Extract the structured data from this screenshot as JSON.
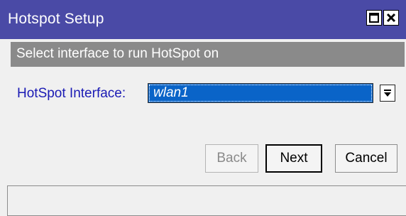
{
  "window": {
    "title": "Hotspot Setup",
    "maximize_icon": "maximize-icon",
    "close_icon": "close-icon"
  },
  "section": {
    "heading": "Select interface to run HotSpot on"
  },
  "form": {
    "interface_label": "HotSpot Interface:",
    "interface_value": "wlan1",
    "dropdown_icon": "dropdown-arrow-icon"
  },
  "buttons": {
    "back": "Back",
    "next": "Next",
    "cancel": "Cancel"
  },
  "status": {
    "text": ""
  },
  "colors": {
    "titlebar": "#4a4aa6",
    "subbar": "#8a8a8a",
    "selected": "#0a64c8",
    "label": "#1a1ab4"
  }
}
